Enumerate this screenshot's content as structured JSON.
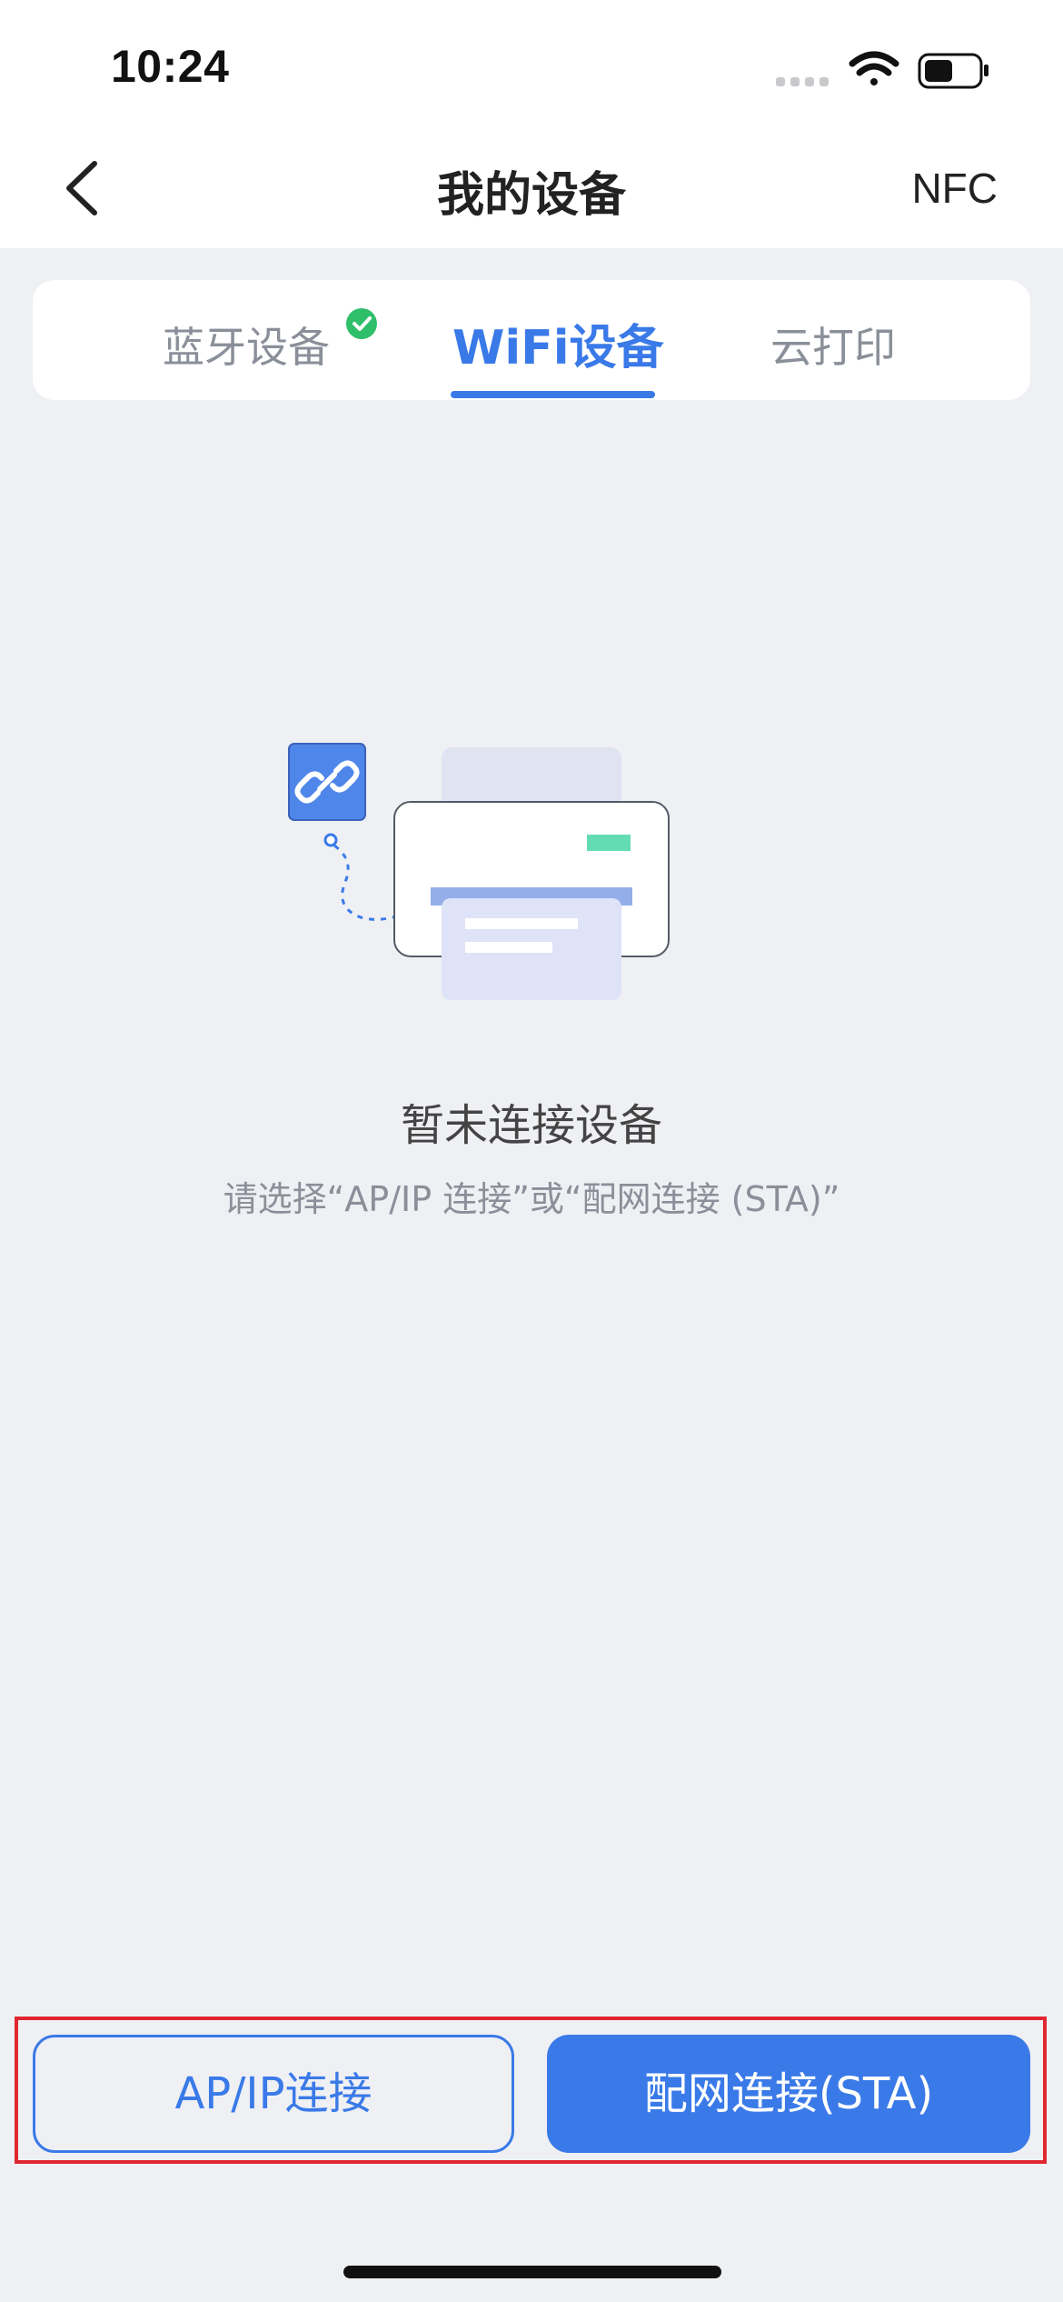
{
  "status_bar": {
    "time": "10:24"
  },
  "nav": {
    "title": "我的设备",
    "right_action": "NFC"
  },
  "tabs": [
    {
      "label": "蓝牙设备",
      "connected": true
    },
    {
      "label": "WiFi设备",
      "active": true
    },
    {
      "label": "云打印"
    }
  ],
  "empty_state": {
    "title": "暂未连接设备",
    "hint": "请选择“AP/IP 连接”或“配网连接 (STA)”"
  },
  "actions": {
    "ap_ip": "AP/IP连接",
    "sta": "配网连接(STA)"
  },
  "colors": {
    "accent": "#3a7ae8",
    "background": "#eff0f4",
    "success": "#2fbf6b",
    "highlight": "#e0262f"
  }
}
